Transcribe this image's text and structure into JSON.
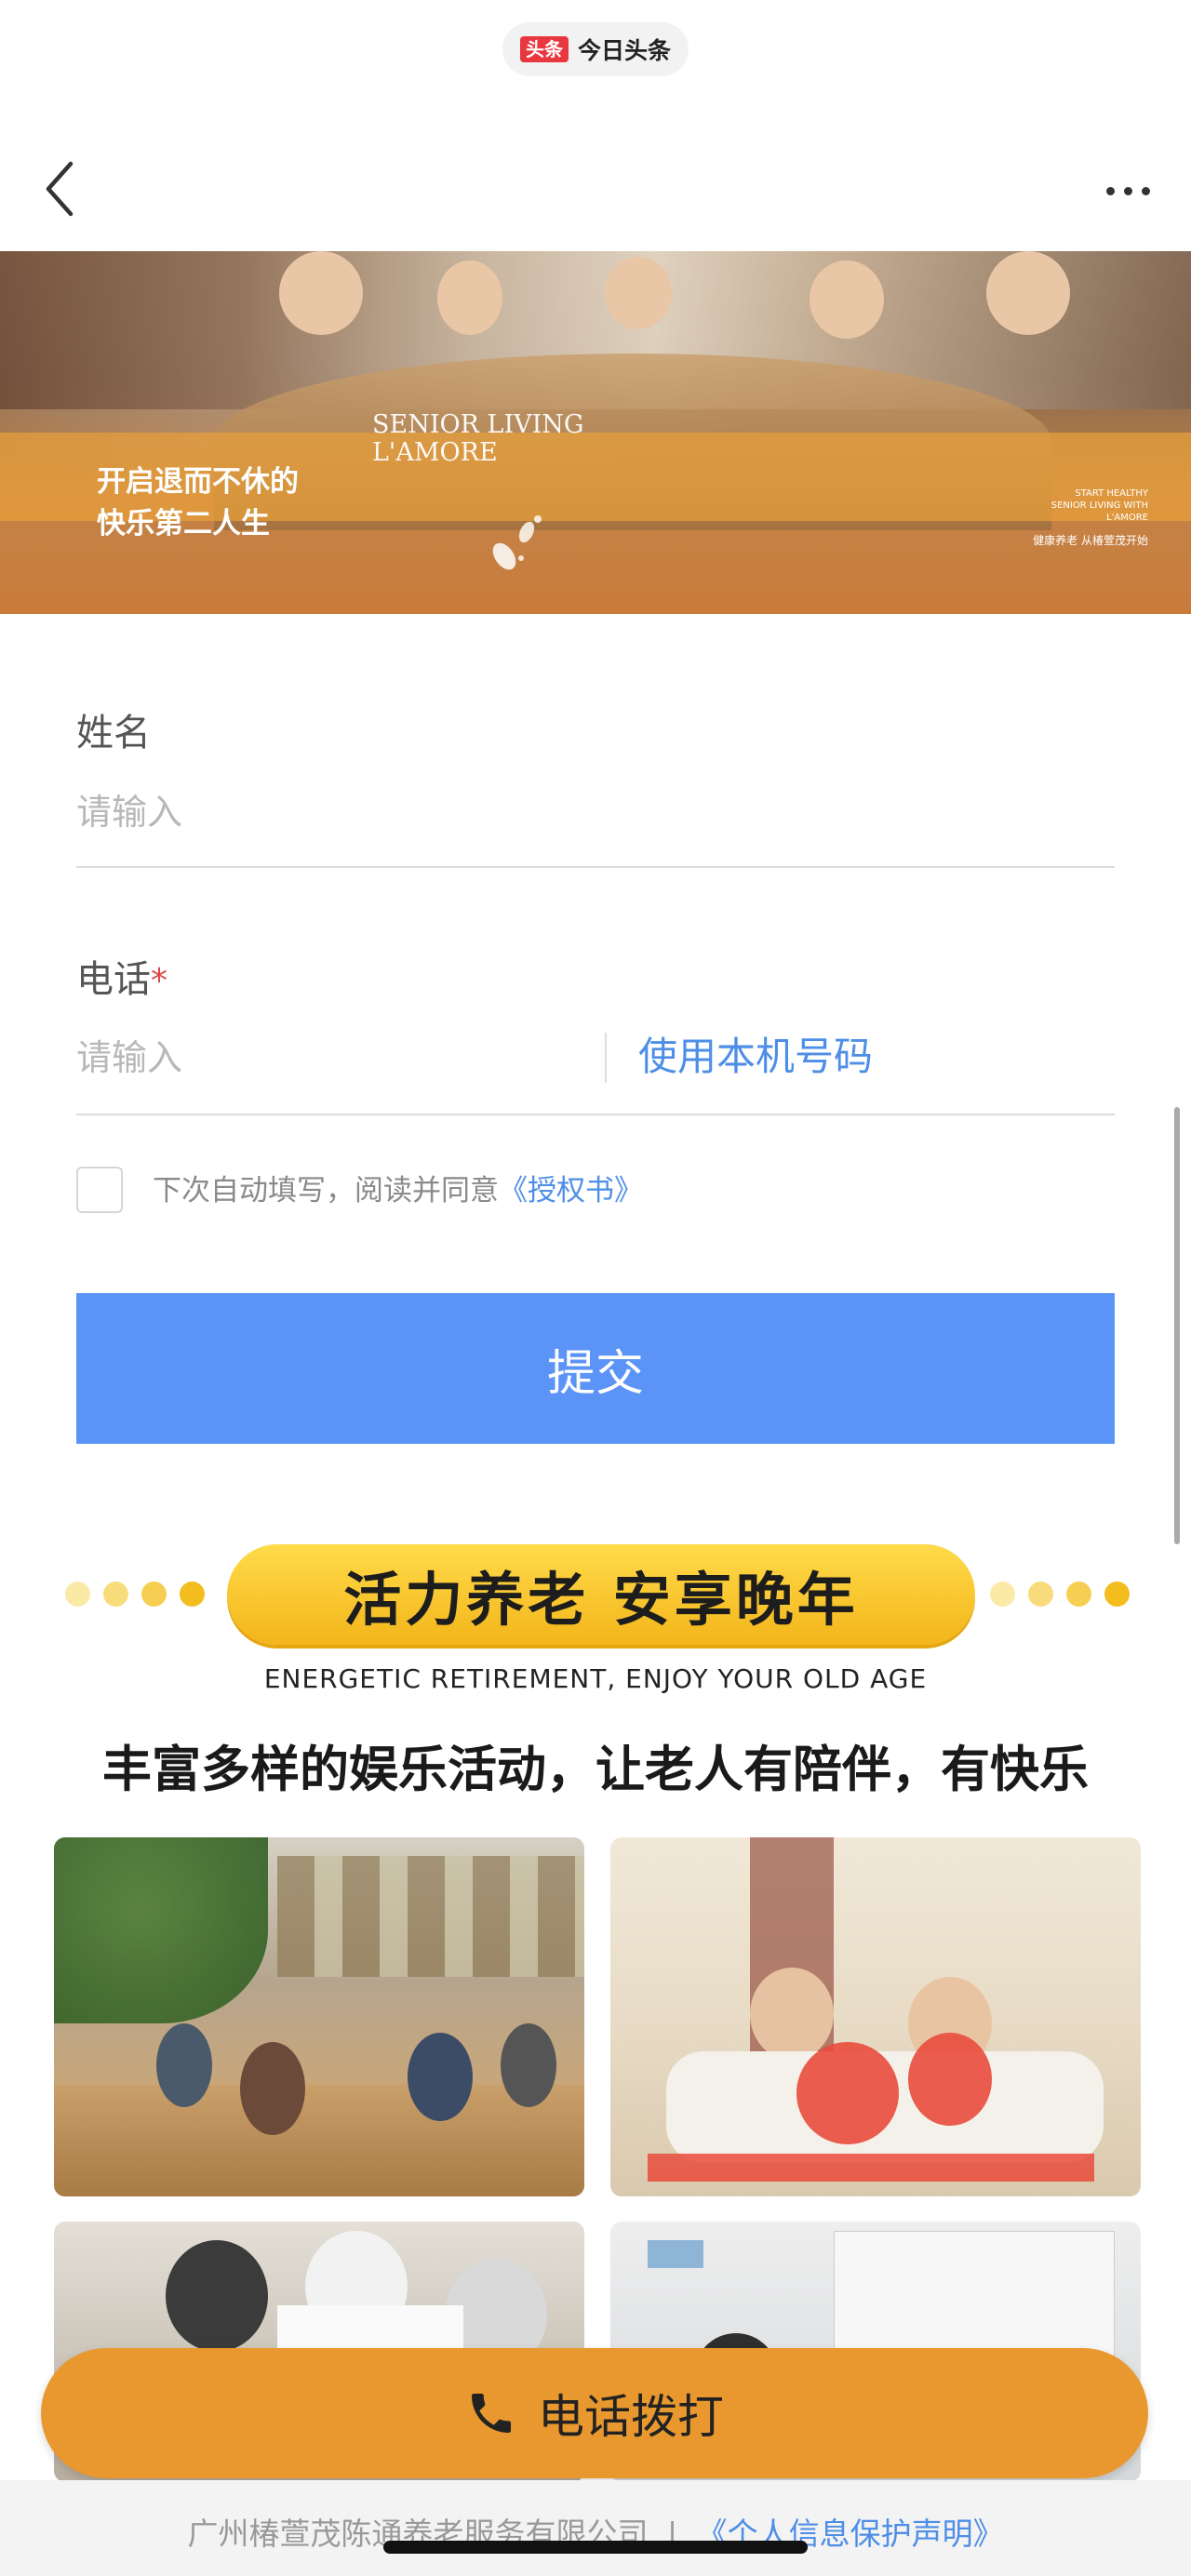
{
  "topbar": {
    "source_logo": "头条",
    "source_name": "今日头条"
  },
  "hero": {
    "title_line1": "开启退而不休的",
    "title_line2": "快乐第二人生",
    "brand_line1": "SENIOR LIVING",
    "brand_line2": "L'AMORE",
    "tag": "START HEALTHY\nSENIOR LIVING WITH\nL'AMORE",
    "sub": "健康养老 从椿萱茂开始"
  },
  "form": {
    "name_label": "姓名",
    "name_placeholder": "请输入",
    "phone_label": "电话",
    "phone_required": "*",
    "phone_placeholder": "请输入",
    "use_phone": "使用本机号码",
    "agree_text": "下次自动填写，阅读并同意",
    "agree_link": "《授权书》",
    "submit_label": "提交"
  },
  "promo": {
    "slogan": "活力养老 安享晚年",
    "slogan_en": "ENERGETIC RETIREMENT, ENJOY YOUR OLD AGE",
    "headline": "丰富多样的娱乐活动，让老人有陪伴，有快乐"
  },
  "call_bar": {
    "label": "电话拨打",
    "icon": "phone-icon"
  },
  "footer": {
    "company": "广州椿萱茂陈通养老服务有限公司",
    "separator": "|",
    "privacy_link": "《个人信息保护声明》"
  },
  "colors": {
    "accent_blue": "#4d8ee6",
    "submit_blue": "#5b93f7",
    "call_orange": "#e9982f",
    "slogan_yellow": "#f3b51a",
    "required_red": "#e0454a"
  }
}
